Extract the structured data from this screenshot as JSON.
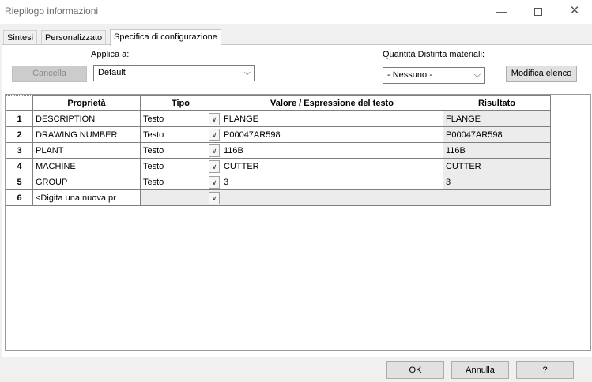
{
  "window": {
    "title": "Riepilogo informazioni"
  },
  "tabs": [
    "Sintesi",
    "Personalizzato",
    "Specifica di configurazione"
  ],
  "toolbar": {
    "cancella_label": "Cancella",
    "applica_label": "Applica a:",
    "applica_value": "Default",
    "quantita_label": "Quantità Distinta materiali:",
    "quantita_value": "- Nessuno -",
    "modifica_label": "Modifica elenco"
  },
  "table": {
    "headers": [
      "Proprietà",
      "Tipo",
      "Valore / Espressione del testo",
      "Risultato"
    ],
    "rows": [
      {
        "num": "1",
        "name": "DESCRIPTION",
        "type": "Testo",
        "value": "FLANGE",
        "result": "FLANGE"
      },
      {
        "num": "2",
        "name": "DRAWING NUMBER",
        "type": "Testo",
        "value": "P00047AR598",
        "result": "P00047AR598"
      },
      {
        "num": "3",
        "name": "PLANT",
        "type": "Testo",
        "value": "116B",
        "result": "116B"
      },
      {
        "num": "4",
        "name": "MACHINE",
        "type": "Testo",
        "value": "CUTTER",
        "result": "CUTTER"
      },
      {
        "num": "5",
        "name": "GROUP",
        "type": "Testo",
        "value": "3",
        "result": "3"
      },
      {
        "num": "6",
        "name": "<Digita una nuova pr",
        "type": "",
        "value": "",
        "result": ""
      }
    ]
  },
  "footer": {
    "ok": "OK",
    "annulla": "Annulla",
    "help": "?"
  }
}
